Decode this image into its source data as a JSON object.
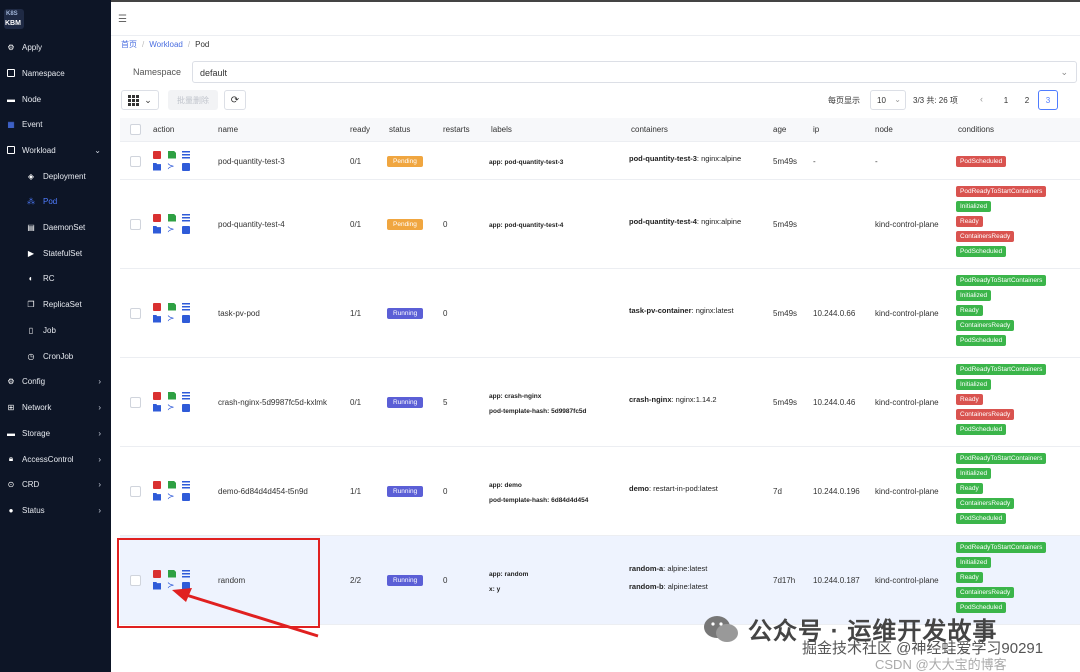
{
  "logo": {
    "top": "K8S",
    "bottom": "KBM"
  },
  "sidebar": {
    "items": [
      {
        "label": "Apply",
        "icon": "gear-icon"
      },
      {
        "label": "Namespace",
        "icon": "namespace-icon"
      },
      {
        "label": "Node",
        "icon": "server-icon"
      },
      {
        "label": "Event",
        "icon": "calendar-icon"
      },
      {
        "label": "Workload",
        "icon": "workload-icon"
      },
      {
        "label": "Deployment",
        "icon": "layers-icon"
      },
      {
        "label": "Pod",
        "icon": "cubes-icon"
      },
      {
        "label": "DaemonSet",
        "icon": "table-icon"
      },
      {
        "label": "StatefulSet",
        "icon": "play-icon"
      },
      {
        "label": "RC",
        "icon": "pill-icon"
      },
      {
        "label": "ReplicaSet",
        "icon": "copy-icon"
      },
      {
        "label": "Job",
        "icon": "document-icon"
      },
      {
        "label": "CronJob",
        "icon": "clock-icon"
      },
      {
        "label": "Config",
        "icon": "config-icon"
      },
      {
        "label": "Network",
        "icon": "network-icon"
      },
      {
        "label": "Storage",
        "icon": "storage-icon"
      },
      {
        "label": "AccessControl",
        "icon": "lock-icon"
      },
      {
        "label": "CRD",
        "icon": "crd-icon"
      },
      {
        "label": "Status",
        "icon": "info-icon"
      }
    ]
  },
  "breadcrumb": {
    "home": "首页",
    "section": "Workload",
    "current": "Pod"
  },
  "namespace": {
    "label": "Namespace",
    "value": "default"
  },
  "toolbar": {
    "bulk_delete": "批量删除"
  },
  "pagination": {
    "per_page_label": "每页显示",
    "page_size": "10",
    "total": "3/3 共: 26 项",
    "pages": [
      "1",
      "2",
      "3"
    ],
    "current": "3"
  },
  "columns": [
    "action",
    "name",
    "ready",
    "status",
    "restarts",
    "labels",
    "containers",
    "age",
    "ip",
    "node",
    "conditions"
  ],
  "rows": [
    {
      "name": "pod-quantity-test-3",
      "ready": "0/1",
      "status": "Pending",
      "restarts": "",
      "labels": [
        "app: pod-quantity-test-3"
      ],
      "containers": [
        {
          "name": "pod-quantity-test-3",
          "image": ": nginx:alpine"
        }
      ],
      "age": "5m49s",
      "ip": "-",
      "node": "-",
      "conditions": [
        {
          "text": "PodScheduled",
          "ok": false
        }
      ]
    },
    {
      "name": "pod-quantity-test-4",
      "ready": "0/1",
      "status": "Pending",
      "restarts": "0",
      "labels": [
        "app: pod-quantity-test-4"
      ],
      "containers": [
        {
          "name": "pod-quantity-test-4",
          "image": ": nginx:alpine"
        }
      ],
      "age": "5m49s",
      "ip": "",
      "node": "kind-control-plane",
      "conditions": [
        {
          "text": "PodReadyToStartContainers",
          "ok": false
        },
        {
          "text": "Initialized",
          "ok": true
        },
        {
          "text": "Ready",
          "ok": false
        },
        {
          "text": "ContainersReady",
          "ok": false
        },
        {
          "text": "PodScheduled",
          "ok": true
        }
      ]
    },
    {
      "name": "task-pv-pod",
      "ready": "1/1",
      "status": "Running",
      "restarts": "0",
      "labels": [],
      "containers": [
        {
          "name": "task-pv-container",
          "image": ": nginx:latest"
        }
      ],
      "age": "5m49s",
      "ip": "10.244.0.66",
      "node": "kind-control-plane",
      "conditions": [
        {
          "text": "PodReadyToStartContainers",
          "ok": true
        },
        {
          "text": "Initialized",
          "ok": true
        },
        {
          "text": "Ready",
          "ok": true
        },
        {
          "text": "ContainersReady",
          "ok": true
        },
        {
          "text": "PodScheduled",
          "ok": true
        }
      ]
    },
    {
      "name": "crash-nginx-5d9987fc5d-kxlmk",
      "ready": "0/1",
      "status": "Running",
      "restarts": "5",
      "labels": [
        "app: crash-nginx",
        "pod-template-hash: 5d9987fc5d"
      ],
      "containers": [
        {
          "name": "crash-nginx",
          "image": ": nginx:1.14.2"
        }
      ],
      "age": "5m49s",
      "ip": "10.244.0.46",
      "node": "kind-control-plane",
      "conditions": [
        {
          "text": "PodReadyToStartContainers",
          "ok": true
        },
        {
          "text": "Initialized",
          "ok": true
        },
        {
          "text": "Ready",
          "ok": false
        },
        {
          "text": "ContainersReady",
          "ok": false
        },
        {
          "text": "PodScheduled",
          "ok": true
        }
      ]
    },
    {
      "name": "demo-6d84d4d454-t5n9d",
      "ready": "1/1",
      "status": "Running",
      "restarts": "0",
      "labels": [
        "app: demo",
        "pod-template-hash: 6d84d4d454"
      ],
      "containers": [
        {
          "name": "demo",
          "image": ": restart-in-pod:latest"
        }
      ],
      "age": "7d",
      "ip": "10.244.0.196",
      "node": "kind-control-plane",
      "conditions": [
        {
          "text": "PodReadyToStartContainers",
          "ok": true
        },
        {
          "text": "Initialized",
          "ok": true
        },
        {
          "text": "Ready",
          "ok": true
        },
        {
          "text": "ContainersReady",
          "ok": true
        },
        {
          "text": "PodScheduled",
          "ok": true
        }
      ]
    },
    {
      "name": "random",
      "ready": "2/2",
      "status": "Running",
      "restarts": "0",
      "labels": [
        "app: random",
        "x: y"
      ],
      "containers": [
        {
          "name": "random-a",
          "image": ": alpine:latest"
        },
        {
          "name": "random-b",
          "image": ": alpine:latest"
        }
      ],
      "age": "7d17h",
      "ip": "10.244.0.187",
      "node": "kind-control-plane",
      "conditions": [
        {
          "text": "PodReadyToStartContainers",
          "ok": true
        },
        {
          "text": "Initialized",
          "ok": true
        },
        {
          "text": "Ready",
          "ok": true
        },
        {
          "text": "ContainersReady",
          "ok": true
        },
        {
          "text": "PodScheduled",
          "ok": true
        }
      ]
    }
  ],
  "status_colors": {
    "Pending": "#f0a640",
    "Running": "#5b5fd6"
  },
  "colors": {
    "accent": "#4f7cff",
    "sidebar_bg": "#0d1526",
    "highlight": "#e02020",
    "condition_ok": "#3bb54a",
    "condition_bad": "#d9534f"
  },
  "watermark": {
    "line1": "公众号 · 运维开发故事",
    "line2": "掘金技术社区 @神经蛙爱学习90291",
    "line3": "CSDN @大大宝的博客"
  }
}
